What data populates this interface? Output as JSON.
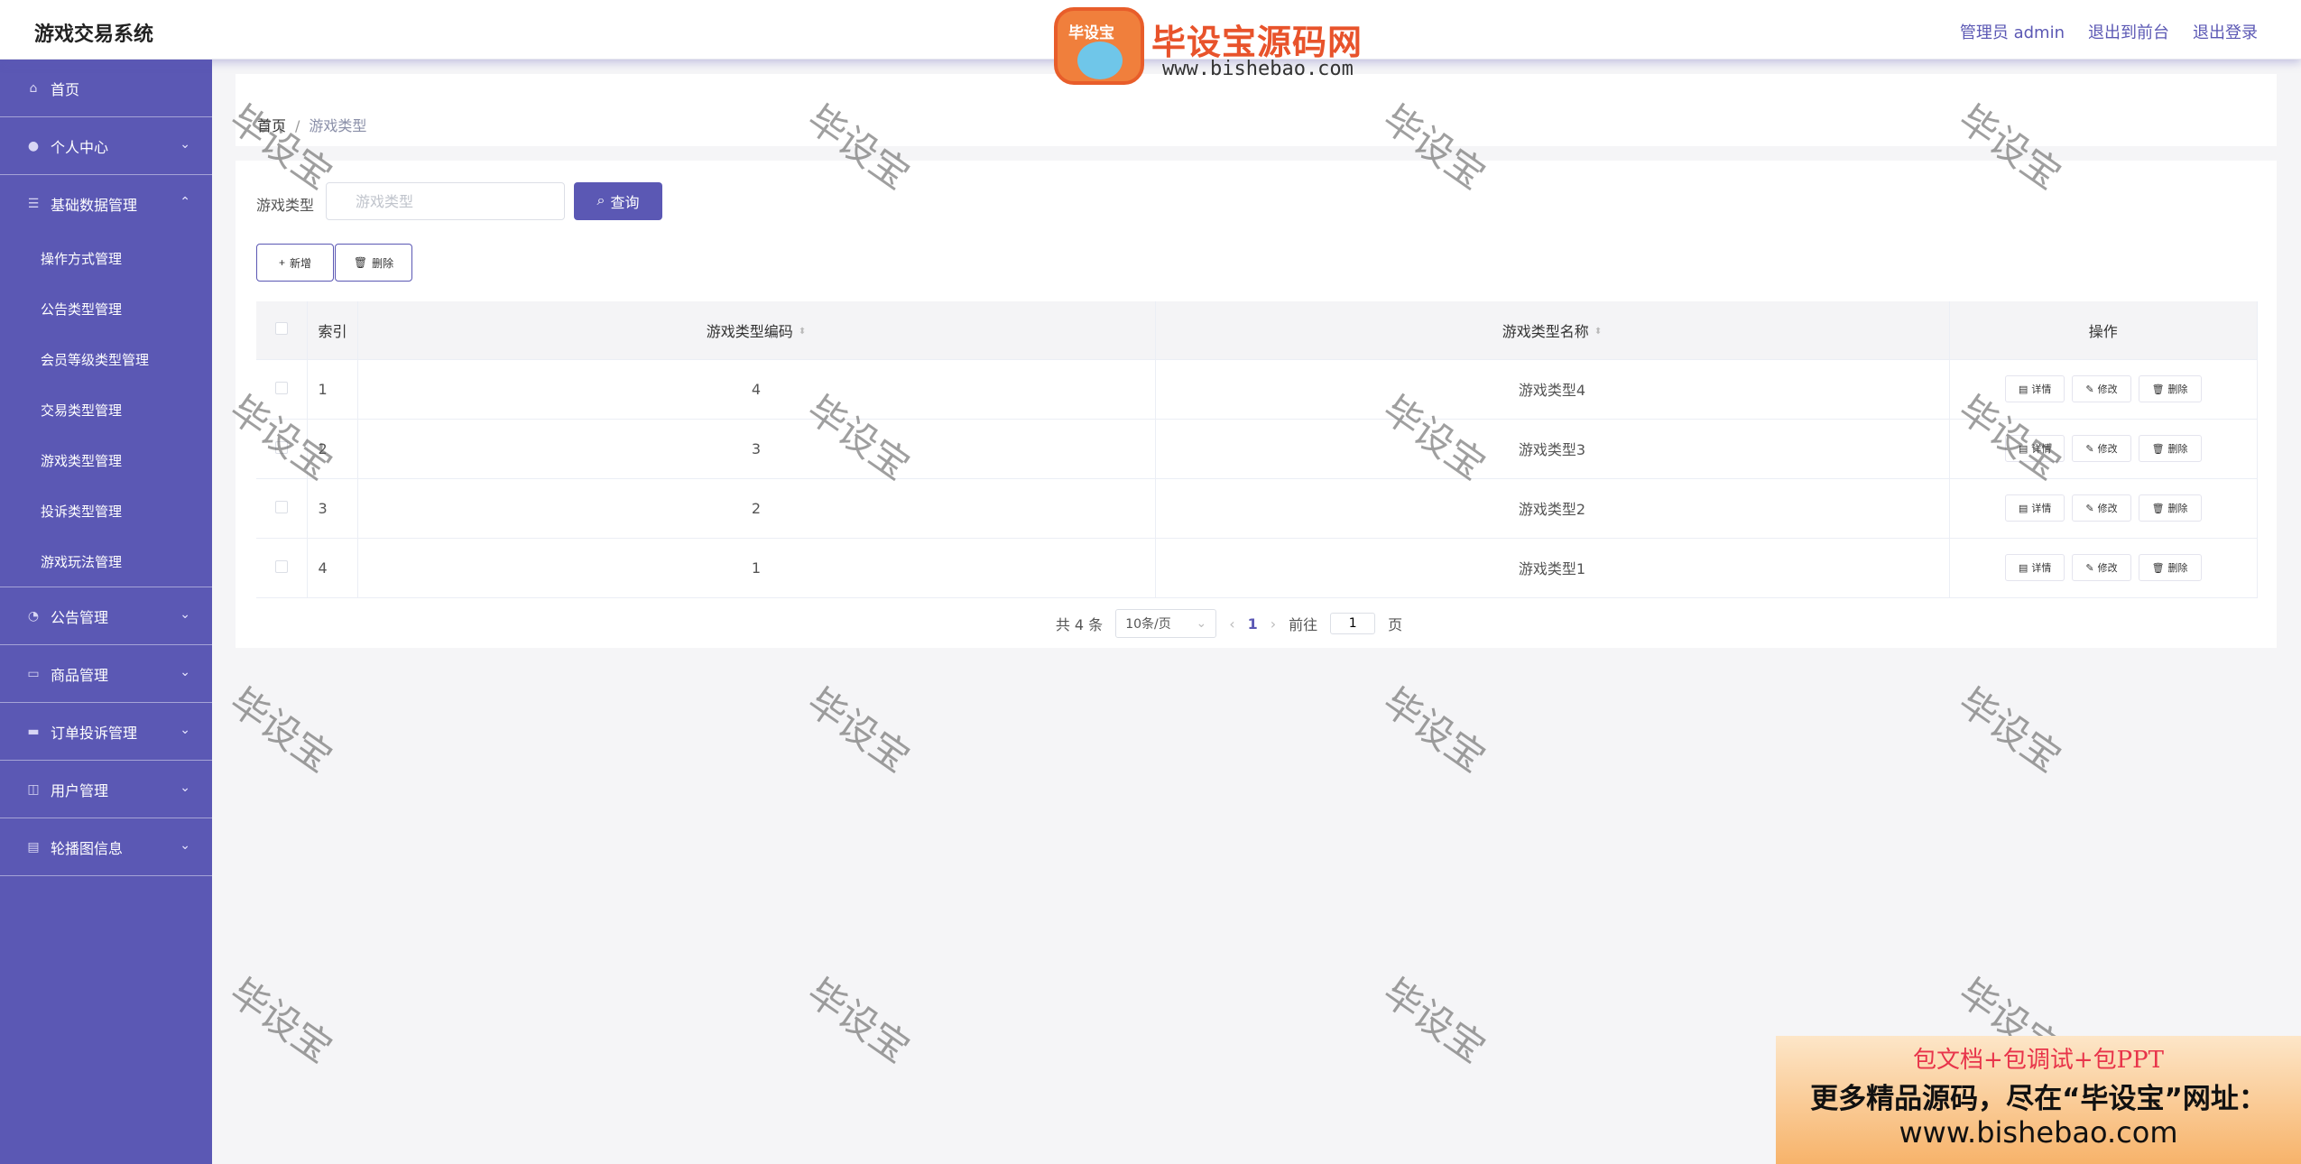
{
  "app": {
    "title": "游戏交易系统"
  },
  "header": {
    "admin": "管理员 admin",
    "to_front": "退出到前台",
    "logout": "退出登录"
  },
  "sidebar": {
    "items": [
      {
        "label": "首页",
        "icon": "home-icon"
      },
      {
        "label": "个人中心",
        "icon": "user-icon"
      },
      {
        "label": "基础数据管理",
        "icon": "menu-icon"
      }
    ],
    "subitems": [
      "操作方式管理",
      "公告类型管理",
      "会员等级类型管理",
      "交易类型管理",
      "游戏类型管理",
      "投诉类型管理",
      "游戏玩法管理"
    ],
    "items2": [
      {
        "label": "公告管理",
        "icon": "notice-icon"
      },
      {
        "label": "商品管理",
        "icon": "goods-icon"
      },
      {
        "label": "订单投诉管理",
        "icon": "order-icon"
      },
      {
        "label": "用户管理",
        "icon": "users-icon"
      },
      {
        "label": "轮播图信息",
        "icon": "carousel-icon"
      }
    ]
  },
  "breadcrumb": {
    "home": "首页",
    "sep": "/",
    "current": "游戏类型"
  },
  "search": {
    "label": "游戏类型",
    "placeholder": "游戏类型",
    "button": "查询"
  },
  "actions": {
    "add": "新增",
    "delete": "删除"
  },
  "table": {
    "headers": {
      "index": "索引",
      "code": "游戏类型编码",
      "name": "游戏类型名称",
      "ops": "操作"
    },
    "rows": [
      {
        "index": "1",
        "code": "4",
        "name": "游戏类型4"
      },
      {
        "index": "2",
        "code": "3",
        "name": "游戏类型3"
      },
      {
        "index": "3",
        "code": "2",
        "name": "游戏类型2"
      },
      {
        "index": "4",
        "code": "1",
        "name": "游戏类型1"
      }
    ],
    "op_labels": {
      "detail": "详情",
      "edit": "修改",
      "delete": "删除"
    }
  },
  "pager": {
    "total": "共 4 条",
    "size": "10条/页",
    "page": "1",
    "goto": "前往",
    "goto_value": "1",
    "page_unit": "页"
  },
  "watermark": {
    "logo_badge": "毕设宝",
    "logo_text": "毕设宝源码网",
    "logo_url": "www.bishebao.com",
    "tile": "毕设宝"
  },
  "banner": {
    "line1": "包文档+包调试+包PPT",
    "line2": "更多精品源码，尽在“毕设宝”网址：",
    "line3": "www.bishebao.com"
  },
  "colors": {
    "accent": "#5b58b4"
  }
}
